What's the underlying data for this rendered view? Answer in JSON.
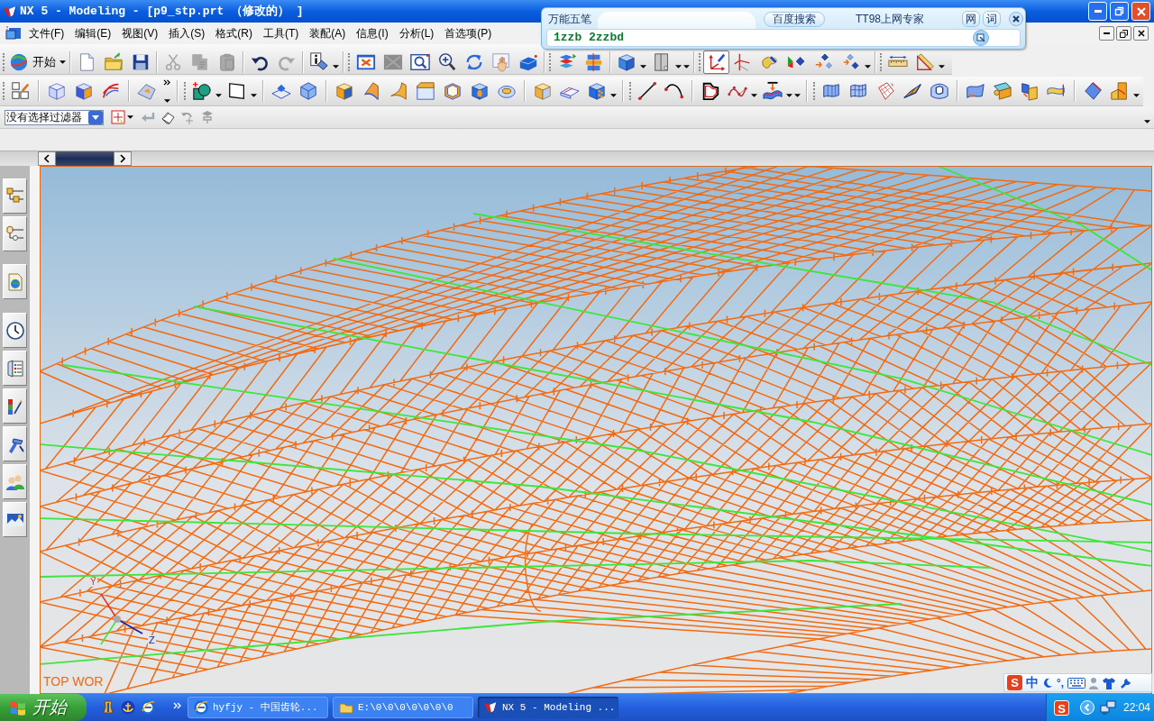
{
  "window": {
    "title": "NX 5 - Modeling - [p9_stp.prt （修改的） ]"
  },
  "menu_bar": {
    "items": [
      "文件(F)",
      "编辑(E)",
      "视图(V)",
      "插入(S)",
      "格式(R)",
      "工具(T)",
      "装配(A)",
      "信息(I)",
      "分析(L)",
      "首选项(P)"
    ]
  },
  "ime_window": {
    "title": "万能五笔",
    "buttons": [
      {
        "label": "百度搜索",
        "kind": "pill"
      },
      {
        "label": "TT98上网专家",
        "kind": "link"
      },
      {
        "label": "网",
        "kind": "square"
      },
      {
        "label": "词",
        "kind": "square"
      }
    ],
    "composition": "1zzb 2zzbd"
  },
  "standard_toolbar": {
    "start_button": "开始",
    "cut": {
      "disabled": true
    },
    "copy": {
      "disabled": true
    },
    "paste": {
      "disabled": true
    },
    "redo": {
      "disabled": true
    }
  },
  "utility_toolbar": {
    "wcs_display": {
      "selected": true
    }
  },
  "selection_bar": {
    "filter": "没有选择过滤器"
  },
  "graphics_window": {
    "view_label": "TOP WOR",
    "triad_labels": [
      "Y",
      "Z"
    ]
  },
  "ime_status_bar": {
    "logo": "S",
    "mode": "中",
    "punctuation": "°,"
  },
  "taskbar": {
    "start_button": "开始",
    "tasks": [
      {
        "label": "hyfjy - 中国齿轮...",
        "selected": false
      },
      {
        "label": "E:\\0\\0\\0\\0\\0\\0\\0",
        "selected": false
      },
      {
        "label": "NX 5 - Modeling ...",
        "selected": true
      }
    ],
    "tray_logo": "S",
    "clock": "22:04"
  }
}
